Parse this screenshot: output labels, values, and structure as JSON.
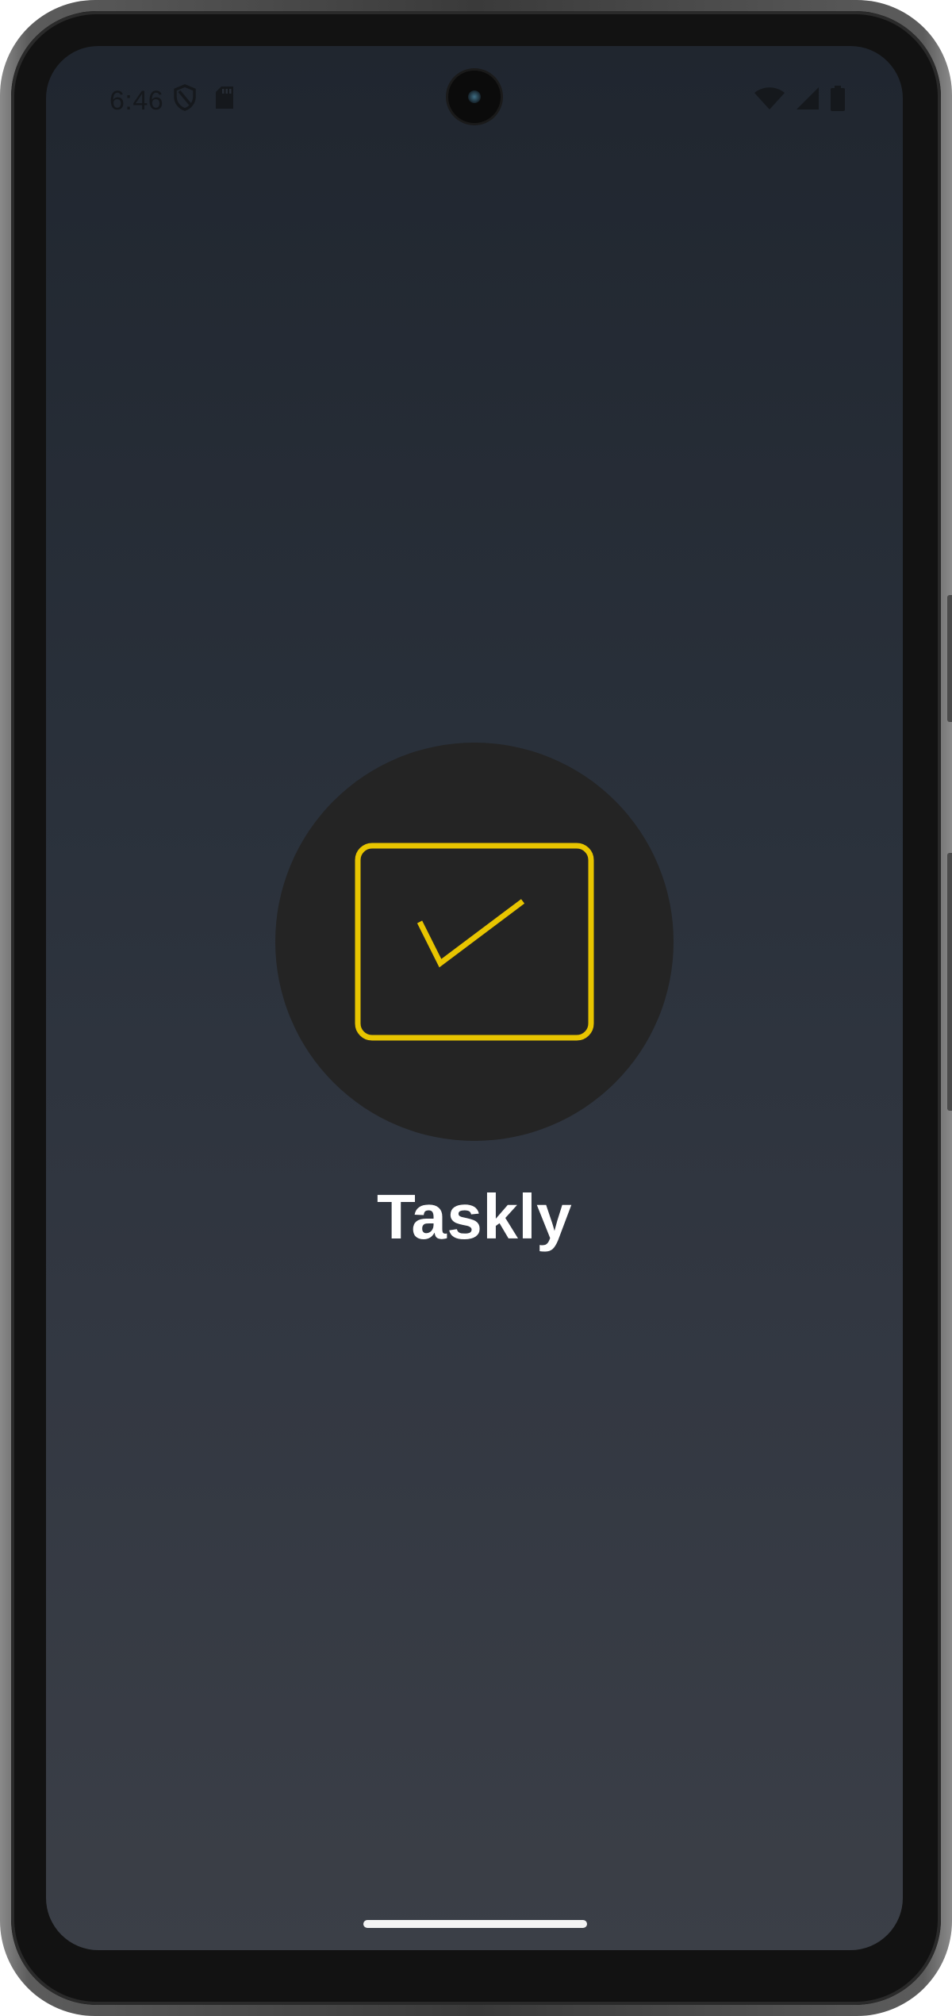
{
  "status_bar": {
    "time": "6:46",
    "left_icons": [
      "shield-icon",
      "sd-card-icon"
    ],
    "right_icons": [
      "wifi-icon",
      "cellular-signal-icon",
      "battery-icon"
    ]
  },
  "splash": {
    "app_name": "Taskly",
    "logo_icon": "checkbox-check-icon",
    "accent_color": "#E8C500",
    "logo_background": "#242424"
  }
}
